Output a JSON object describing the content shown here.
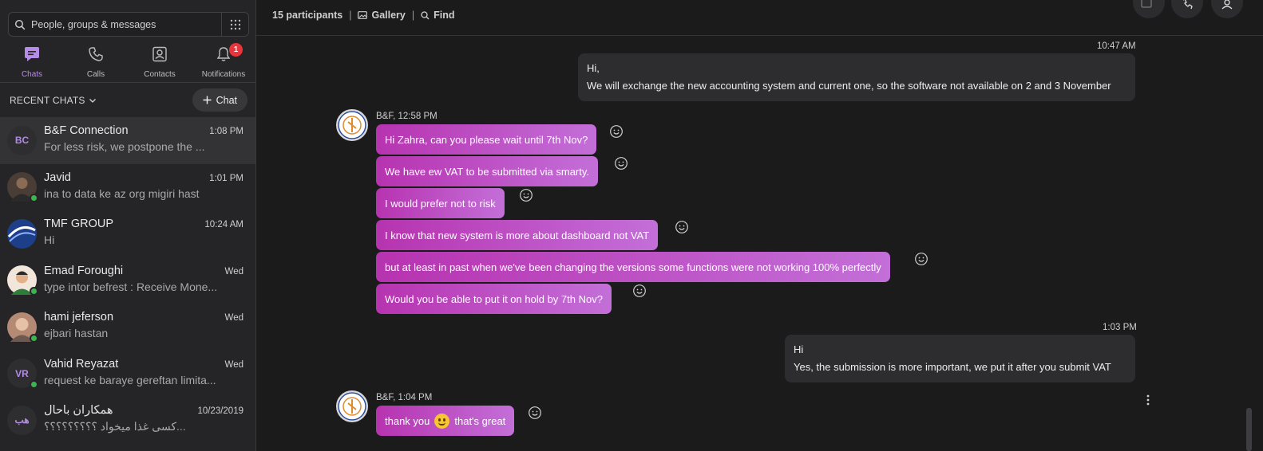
{
  "search": {
    "placeholder": "People, groups & messages"
  },
  "nav": {
    "tabs": [
      {
        "label": "Chats",
        "icon": "chat-icon",
        "active": true
      },
      {
        "label": "Calls",
        "icon": "phone-icon"
      },
      {
        "label": "Contacts",
        "icon": "contacts-icon"
      },
      {
        "label": "Notifications",
        "icon": "bell-icon",
        "badge": "1"
      }
    ]
  },
  "recent": {
    "title": "RECENT CHATS",
    "new_chat_label": "Chat"
  },
  "chats": [
    {
      "initials": "BC",
      "name": "B&F Connection",
      "time": "1:08 PM",
      "preview": "For less risk, we postpone the ...",
      "active": true
    },
    {
      "initials": "",
      "name": "Javid",
      "time": "1:01 PM",
      "preview": "ina to data ke az org migiri hast",
      "online": true
    },
    {
      "initials": "",
      "name": "TMF GROUP",
      "time": "10:24 AM",
      "preview": "Hi"
    },
    {
      "initials": "",
      "name": "Emad Foroughi",
      "time": "Wed",
      "preview": "type intor befrest : Receive Mone...",
      "online": true
    },
    {
      "initials": "",
      "name": "hami jeferson",
      "time": "Wed",
      "preview": "ejbari hastan",
      "online": true
    },
    {
      "initials": "VR",
      "name": "Vahid Reyazat",
      "time": "Wed",
      "preview": "request ke baraye gereftan limita...",
      "online": true
    },
    {
      "initials": "هب",
      "name": "همکاران باحال",
      "time": "10/23/2019",
      "preview": "...کسی غذا میخواد ؟؟؟؟؟؟؟؟؟"
    }
  ],
  "header": {
    "participants": "15 participants",
    "gallery": "Gallery",
    "find": "Find",
    "separator": "|"
  },
  "messages": {
    "out1": {
      "time": "10:47 AM",
      "line1": "Hi,",
      "line2": "We will exchange the new accounting system and current one, so the software not available on 2 and 3 November"
    },
    "in1": {
      "sender": "B&F, 12:58 PM",
      "bubbles": [
        "Hi Zahra, can you please wait until 7th Nov?",
        "We have ew VAT to be submitted via smarty.",
        "I would prefer not to risk",
        "I know that new system is more about dashboard not VAT",
        "but at least in past when we've been changing the versions some functions were not working 100% perfectly",
        "Would you be able to put it on hold by 7th Nov?"
      ]
    },
    "out2": {
      "time": "1:03 PM",
      "line1": "Hi",
      "line2": "Yes, the submission is more important, we put it after you submit VAT"
    },
    "in2": {
      "sender": "B&F, 1:04 PM",
      "text_before": "thank you",
      "text_after": "that's great"
    }
  },
  "colors": {
    "accent": "#b58de8",
    "bubble_in_start": "#b733b0",
    "bubble_in_end": "#c36fd8",
    "online": "#3fb34f",
    "badge": "#e8343b"
  }
}
